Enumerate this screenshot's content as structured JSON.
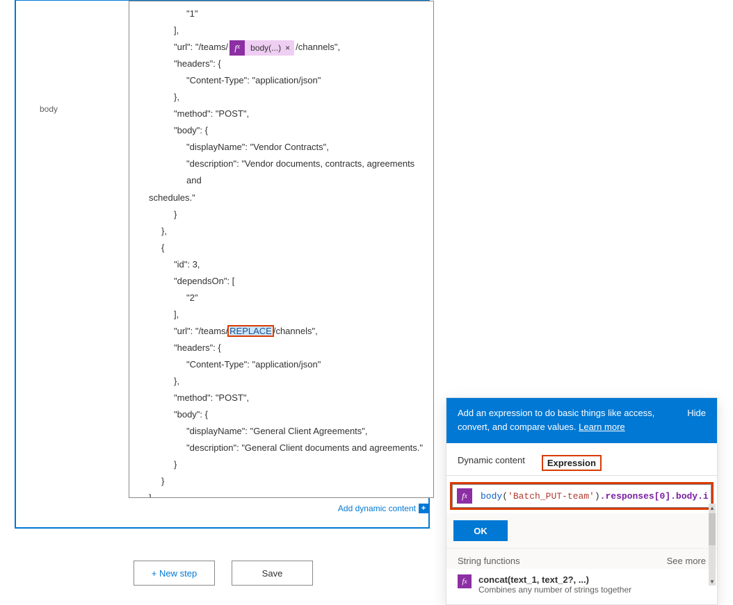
{
  "field_label": "body",
  "editor": {
    "line_pre_url": "\"url\": \"/teams/",
    "line_post_url": "/channels\",",
    "token_label": "body(...)",
    "replace_text": "REPLACE",
    "lines_a": [
      {
        "cls": "ind4",
        "text": "\"1\""
      },
      {
        "cls": "ind3",
        "text": "],"
      }
    ],
    "lines_b": [
      {
        "cls": "ind3",
        "text": "\"headers\": {"
      },
      {
        "cls": "ind4",
        "text": "\"Content-Type\": \"application/json\""
      },
      {
        "cls": "ind3",
        "text": "},"
      },
      {
        "cls": "ind3",
        "text": "\"method\": \"POST\","
      },
      {
        "cls": "ind3",
        "text": "\"body\": {"
      },
      {
        "cls": "ind4",
        "text": "\"displayName\": \"Vendor Contracts\","
      },
      {
        "cls": "ind4",
        "text": "\"description\": \"Vendor documents, contracts, agreements and"
      },
      {
        "cls": "ind1",
        "text": "schedules.\""
      },
      {
        "cls": "ind3",
        "text": "}"
      },
      {
        "cls": "ind2",
        "text": "},"
      },
      {
        "cls": "ind2",
        "text": "{"
      },
      {
        "cls": "ind3",
        "text": "\"id\": 3,"
      },
      {
        "cls": "ind3",
        "text": "\"dependsOn\": ["
      },
      {
        "cls": "ind4",
        "text": "\"2\""
      },
      {
        "cls": "ind3",
        "text": "],"
      }
    ],
    "lines_c": [
      {
        "cls": "ind3",
        "text": "\"headers\": {"
      },
      {
        "cls": "ind4",
        "text": "\"Content-Type\": \"application/json\""
      },
      {
        "cls": "ind3",
        "text": "},"
      },
      {
        "cls": "ind3",
        "text": "\"method\": \"POST\","
      },
      {
        "cls": "ind3",
        "text": "\"body\": {"
      },
      {
        "cls": "ind4",
        "text": "\"displayName\": \"General Client Agreements\","
      },
      {
        "cls": "ind4",
        "text": "\"description\": \"General Client documents and agreements.\""
      },
      {
        "cls": "ind3",
        "text": "}"
      },
      {
        "cls": "ind2",
        "text": "}"
      },
      {
        "cls": "ind1",
        "text": "]"
      },
      {
        "cls": "",
        "text": "}"
      }
    ]
  },
  "add_dynamic_label": "Add dynamic content",
  "buttons": {
    "new_step": "+ New step",
    "save": "Save"
  },
  "popup": {
    "header_text": "Add an expression to do basic things like access, convert, and compare values. ",
    "learn_more": "Learn more",
    "hide": "Hide",
    "tab_dynamic": "Dynamic content",
    "tab_expression": "Expression",
    "expression_fn": "body",
    "expression_arg": "'Batch_PUT-team'",
    "expression_tail": ".responses[0].body.i",
    "ok": "OK",
    "section_title": "String functions",
    "see_more": "See more",
    "fn_name": "concat(text_1, text_2?, ...)",
    "fn_desc": "Combines any number of strings together"
  }
}
